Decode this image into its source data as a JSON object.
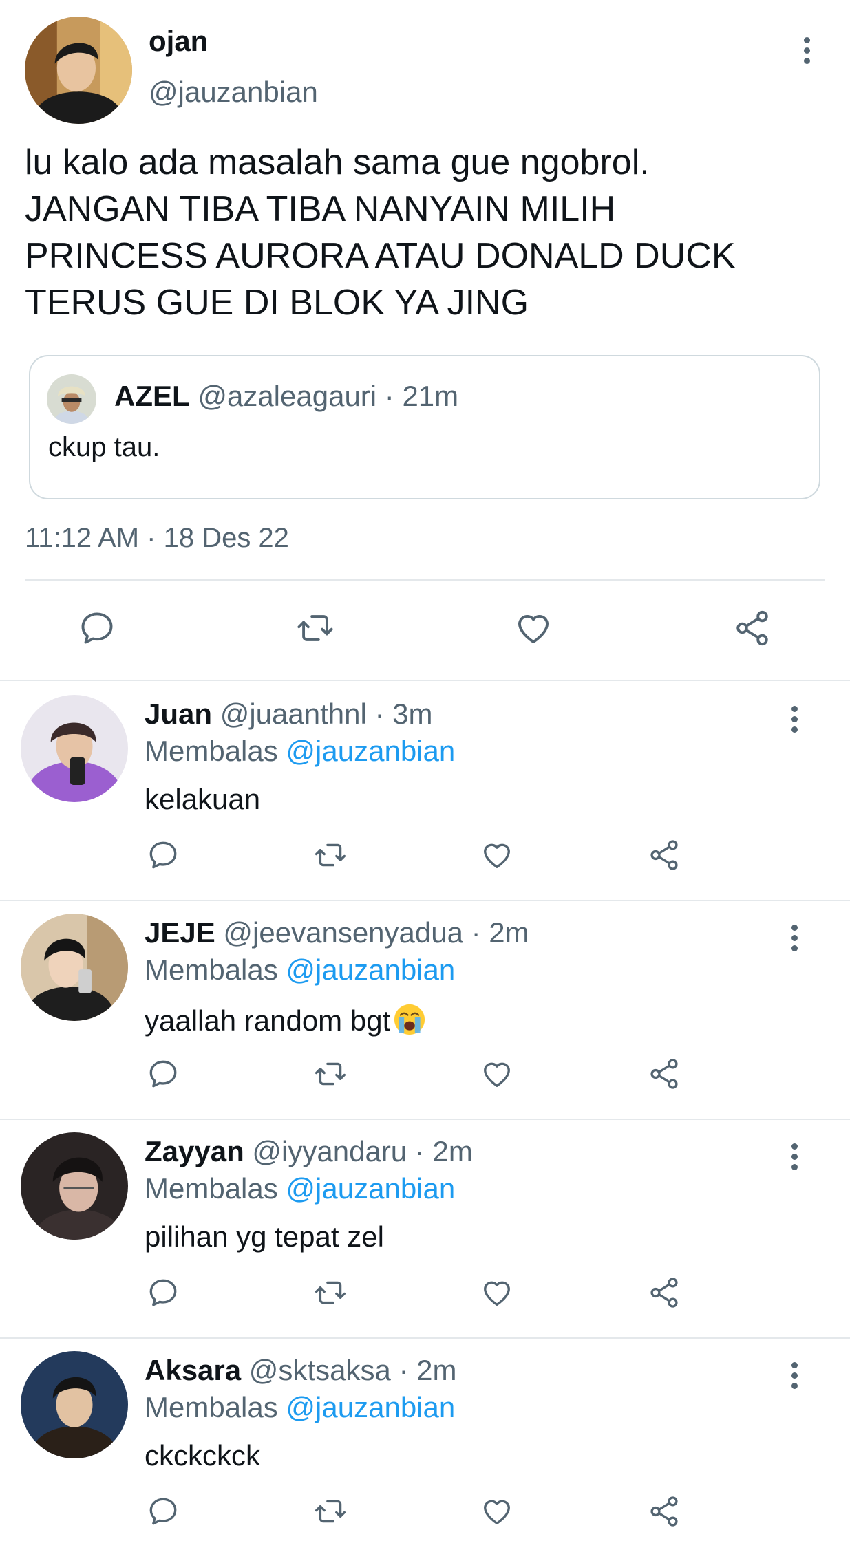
{
  "main_tweet": {
    "display_name": "ojan",
    "handle": "@jauzanbian",
    "text": "lu kalo ada masalah sama gue ngobrol.\nJANGAN TIBA TIBA NANYAIN MILIH\nPRINCESS AURORA ATAU DONALD DUCK\nTERUS GUE DI BLOK YA JING",
    "quote": {
      "display_name": "AZEL",
      "handle": "@azaleagauri",
      "time": "· 21m",
      "text": "ckup tau."
    },
    "timestamp": "11:12 AM · 18 Des 22"
  },
  "reply_prefix": "Membalas",
  "replies": [
    {
      "display_name": "Juan",
      "handle": "@juaanthnl",
      "time": "· 3m",
      "reply_to": "@jauzanbian",
      "text": "kelakuan",
      "emoji": ""
    },
    {
      "display_name": "JEJE",
      "handle": "@jeevansenyadua",
      "time": "· 2m",
      "reply_to": "@jauzanbian",
      "text": "yaallah random bgt",
      "emoji": "loudly-crying-face"
    },
    {
      "display_name": "Zayyan",
      "handle": "@iyyandaru",
      "time": "· 2m",
      "reply_to": "@jauzanbian",
      "text": "pilihan yg tepat zel",
      "emoji": ""
    },
    {
      "display_name": "Aksara",
      "handle": "@sktsaksa",
      "time": "· 2m",
      "reply_to": "@jauzanbian",
      "text": "ckckckck",
      "emoji": ""
    }
  ],
  "icons": {
    "reply": "reply-icon",
    "retweet": "retweet-icon",
    "like": "like-icon",
    "share": "share-icon",
    "more": "more-vertical-icon"
  },
  "colors": {
    "text": "#0f1419",
    "secondary": "#536471",
    "link": "#1d9bf0",
    "divider": "#e4e8eb"
  }
}
